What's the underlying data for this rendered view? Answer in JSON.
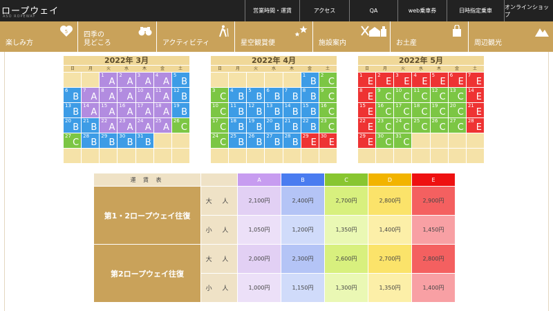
{
  "header": {
    "logo": "ロープウェイ",
    "logo_sub": "ASO ROPEWAY",
    "nav": [
      "営業時間・運賃",
      "アクセス",
      "QA",
      "web乗車券",
      "日時指定乗車",
      "オンラインショップ"
    ]
  },
  "main_nav": [
    {
      "label": "楽しみ方",
      "icon": "heart-icon"
    },
    {
      "label": "四季の\n見どころ",
      "icon": "binoculars-icon"
    },
    {
      "label": "アクティビティ",
      "icon": "hiker-icon"
    },
    {
      "label": "星空観賞便",
      "icon": "stars-icon"
    },
    {
      "label": "施設案内",
      "icon": "facility-icon"
    },
    {
      "label": "お土産",
      "icon": "bag-icon"
    },
    {
      "label": "周辺観光",
      "icon": "mountain-icon"
    }
  ],
  "calendar": {
    "weekdays": [
      "日",
      "月",
      "火",
      "水",
      "木",
      "金",
      "土"
    ],
    "rank_colors": {
      "A": "#b28ce0",
      "B": "#3d9ce6",
      "C": "#7cc644",
      "E": "#ee3333"
    },
    "months": [
      {
        "title": "2022年 3月",
        "cells": [
          [
            "",
            ""
          ],
          [
            "",
            ""
          ],
          [
            "1",
            "A"
          ],
          [
            "2",
            "A"
          ],
          [
            "3",
            "A"
          ],
          [
            "4",
            "A"
          ],
          [
            "5",
            "B"
          ],
          [
            "6",
            "B"
          ],
          [
            "7",
            "A"
          ],
          [
            "8",
            "A"
          ],
          [
            "9",
            "A"
          ],
          [
            "10",
            "A"
          ],
          [
            "11",
            "A"
          ],
          [
            "12",
            "B"
          ],
          [
            "13",
            "B"
          ],
          [
            "14",
            "A"
          ],
          [
            "15",
            "A"
          ],
          [
            "16",
            "A"
          ],
          [
            "17",
            "A"
          ],
          [
            "18",
            "A"
          ],
          [
            "19",
            "B"
          ],
          [
            "20",
            "B"
          ],
          [
            "21",
            "B"
          ],
          [
            "22",
            "A"
          ],
          [
            "23",
            "A"
          ],
          [
            "24",
            "A"
          ],
          [
            "25",
            "A"
          ],
          [
            "26",
            "C"
          ],
          [
            "27",
            "C"
          ],
          [
            "28",
            "B"
          ],
          [
            "29",
            "B"
          ],
          [
            "30",
            "B"
          ],
          [
            "31",
            "B"
          ],
          [
            "",
            ""
          ],
          [
            "",
            ""
          ],
          [
            "",
            ""
          ],
          [
            "",
            ""
          ],
          [
            "",
            ""
          ],
          [
            "",
            ""
          ],
          [
            "",
            ""
          ],
          [
            "",
            ""
          ],
          [
            "",
            ""
          ]
        ]
      },
      {
        "title": "2022年 4月",
        "cells": [
          [
            "",
            ""
          ],
          [
            "",
            ""
          ],
          [
            "",
            ""
          ],
          [
            "",
            ""
          ],
          [
            "",
            ""
          ],
          [
            "1",
            "B"
          ],
          [
            "2",
            "C"
          ],
          [
            "3",
            "C"
          ],
          [
            "4",
            "B"
          ],
          [
            "5",
            "B"
          ],
          [
            "6",
            "B"
          ],
          [
            "7",
            "B"
          ],
          [
            "8",
            "B"
          ],
          [
            "9",
            "C"
          ],
          [
            "10",
            "C"
          ],
          [
            "11",
            "B"
          ],
          [
            "12",
            "B"
          ],
          [
            "13",
            "B"
          ],
          [
            "14",
            "B"
          ],
          [
            "15",
            "B"
          ],
          [
            "16",
            "C"
          ],
          [
            "17",
            "C"
          ],
          [
            "18",
            "B"
          ],
          [
            "19",
            "B"
          ],
          [
            "20",
            "B"
          ],
          [
            "21",
            "B"
          ],
          [
            "22",
            "B"
          ],
          [
            "23",
            "C"
          ],
          [
            "24",
            "C"
          ],
          [
            "25",
            "B"
          ],
          [
            "26",
            "B"
          ],
          [
            "27",
            "B"
          ],
          [
            "28",
            "B"
          ],
          [
            "29",
            "E"
          ],
          [
            "30",
            "E"
          ],
          [
            "",
            ""
          ],
          [
            "",
            ""
          ],
          [
            "",
            ""
          ],
          [
            "",
            ""
          ],
          [
            "",
            ""
          ],
          [
            "",
            ""
          ],
          [
            "",
            ""
          ]
        ]
      },
      {
        "title": "2022年 5月",
        "cells": [
          [
            "1",
            "E"
          ],
          [
            "2",
            "E"
          ],
          [
            "3",
            "E"
          ],
          [
            "4",
            "E"
          ],
          [
            "5",
            "E"
          ],
          [
            "6",
            "E"
          ],
          [
            "7",
            "E"
          ],
          [
            "8",
            "E"
          ],
          [
            "9",
            "C"
          ],
          [
            "10",
            "C"
          ],
          [
            "11",
            "C"
          ],
          [
            "12",
            "C"
          ],
          [
            "13",
            "C"
          ],
          [
            "14",
            "E"
          ],
          [
            "15",
            "E"
          ],
          [
            "16",
            "C"
          ],
          [
            "17",
            "C"
          ],
          [
            "18",
            "C"
          ],
          [
            "19",
            "C"
          ],
          [
            "20",
            "C"
          ],
          [
            "21",
            "E"
          ],
          [
            "22",
            "E"
          ],
          [
            "23",
            "C"
          ],
          [
            "24",
            "C"
          ],
          [
            "25",
            "C"
          ],
          [
            "26",
            "C"
          ],
          [
            "27",
            "C"
          ],
          [
            "28",
            "E"
          ],
          [
            "29",
            "E"
          ],
          [
            "30",
            "C"
          ],
          [
            "31",
            "C"
          ],
          [
            "",
            ""
          ],
          [
            "",
            ""
          ],
          [
            "",
            ""
          ],
          [
            "",
            ""
          ],
          [
            "",
            ""
          ],
          [
            "",
            ""
          ],
          [
            "",
            ""
          ],
          [
            "",
            ""
          ],
          [
            "",
            ""
          ],
          [
            "",
            ""
          ],
          [
            "",
            ""
          ]
        ]
      }
    ]
  },
  "fare_table": {
    "title": "運 賃 表",
    "ranks": [
      {
        "label": "A",
        "color": "#c79cf0",
        "cell": "#e2d0f4",
        "cell2": "#ece0f8"
      },
      {
        "label": "B",
        "color": "#4a7cf0",
        "cell": "#b4c4f6",
        "cell2": "#d0dbfa"
      },
      {
        "label": "C",
        "color": "#88c630",
        "cell": "#d8f07e",
        "cell2": "#eaf8b4"
      },
      {
        "label": "D",
        "color": "#f2b400",
        "cell": "#fbe36a",
        "cell2": "#fcefa8"
      },
      {
        "label": "E",
        "color": "#ee1111",
        "cell": "#f46060",
        "cell2": "#f8a0a4"
      }
    ],
    "groups": [
      {
        "name": "第1・2ロープウェイ往復",
        "rows": [
          {
            "age": "大 人",
            "prices": [
              "2,100円",
              "2,400円",
              "2,700円",
              "2,800円",
              "2,900円"
            ]
          },
          {
            "age": "小 人",
            "prices": [
              "1,050円",
              "1,200円",
              "1,350円",
              "1,400円",
              "1,450円"
            ]
          }
        ]
      },
      {
        "name": "第2ロープウェイ往復",
        "rows": [
          {
            "age": "大 人",
            "prices": [
              "2,000円",
              "2,300円",
              "2,600円",
              "2,700円",
              "2,800円"
            ]
          },
          {
            "age": "小 人",
            "prices": [
              "1,000円",
              "1,150円",
              "1,300円",
              "1,350円",
              "1,400円"
            ]
          }
        ]
      }
    ]
  }
}
